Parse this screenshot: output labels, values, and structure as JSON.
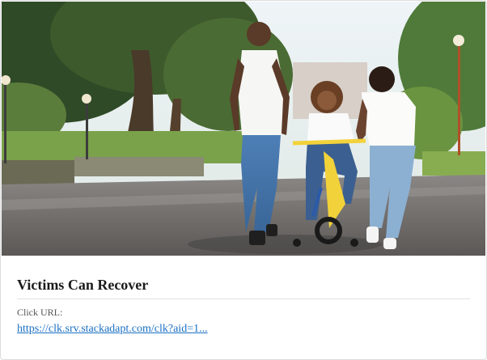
{
  "ad": {
    "title": "Victims Can Recover",
    "url_label": "Click URL:",
    "url_text": "https://clk.srv.stackadapt.com/clk?aid=1...",
    "image_subject": "family walking in park with child on bicycle"
  },
  "colors": {
    "title": "#1a1a1a",
    "link": "#1a6fc4",
    "label": "#555555",
    "border": "#dcdcdc"
  }
}
